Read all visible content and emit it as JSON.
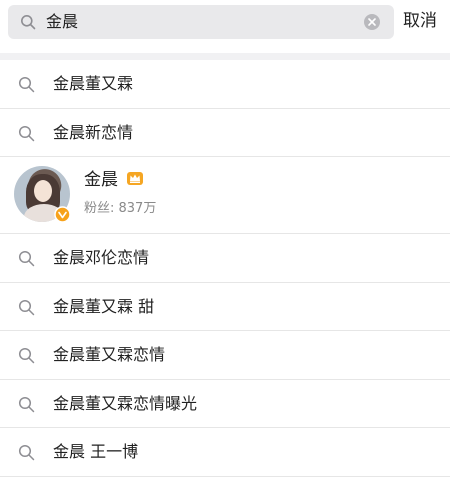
{
  "search": {
    "query": "金晨",
    "cancel_label": "取消"
  },
  "user_result": {
    "name": "金晨",
    "fans": "粉丝: 837万"
  },
  "suggestions": [
    "金晨董又霖",
    "金晨新恋情",
    "金晨邓伦恋情",
    "金晨董又霖 甜",
    "金晨董又霖恋情",
    "金晨董又霖恋情曝光",
    "金晨 王一博"
  ],
  "icons": {
    "search": "search-icon",
    "clear": "clear-icon",
    "crown": "crown-icon",
    "verified": "verified-badge-icon"
  },
  "colors": {
    "search_bg": "#e9e9eb",
    "badge": "#f7a21b",
    "crown": "#f5a623"
  }
}
